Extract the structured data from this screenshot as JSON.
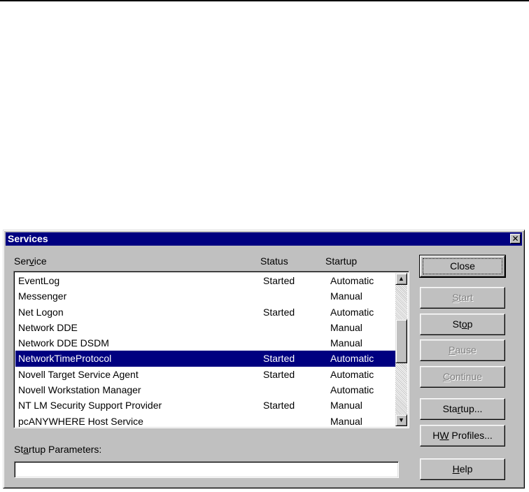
{
  "dialog": {
    "title": "Services"
  },
  "columns": {
    "service": {
      "pre": "Ser",
      "key": "v",
      "post": "ice"
    },
    "status": "Status",
    "startup": "Startup"
  },
  "services": [
    {
      "name": "EventLog",
      "status": "Started",
      "startup": "Automatic"
    },
    {
      "name": "Messenger",
      "status": "",
      "startup": "Manual"
    },
    {
      "name": "Net Logon",
      "status": "Started",
      "startup": "Automatic"
    },
    {
      "name": "Network DDE",
      "status": "",
      "startup": "Manual"
    },
    {
      "name": "Network DDE DSDM",
      "status": "",
      "startup": "Manual"
    },
    {
      "name": "NetworkTimeProtocol",
      "status": "Started",
      "startup": "Automatic"
    },
    {
      "name": "Novell Target Service Agent",
      "status": "Started",
      "startup": "Automatic"
    },
    {
      "name": "Novell Workstation Manager",
      "status": "",
      "startup": "Automatic"
    },
    {
      "name": "NT LM Security Support Provider",
      "status": "Started",
      "startup": "Manual"
    },
    {
      "name": "pcANYWHERE Host Service",
      "status": "",
      "startup": "Manual"
    }
  ],
  "selected_index": 5,
  "buttons": {
    "close": {
      "pre": "Close",
      "key": "",
      "post": ""
    },
    "start": {
      "pre": "",
      "key": "S",
      "post": "tart"
    },
    "stop": {
      "pre": "St",
      "key": "o",
      "post": "p"
    },
    "pause": {
      "pre": "",
      "key": "P",
      "post": "ause"
    },
    "continue": {
      "pre": "",
      "key": "C",
      "post": "ontinue"
    },
    "startup": {
      "pre": "Sta",
      "key": "r",
      "post": "tup..."
    },
    "hw_profiles": {
      "pre": "H",
      "key": "W",
      "post": " Profiles..."
    },
    "help": {
      "pre": "",
      "key": "H",
      "post": "elp"
    }
  },
  "startup_parameters": {
    "label": {
      "pre": "St",
      "key": "a",
      "post": "rtup Parameters:"
    },
    "value": ""
  },
  "icons": {
    "close": "close-icon",
    "scroll_up": "arrow-up-icon",
    "scroll_down": "arrow-down-icon"
  }
}
